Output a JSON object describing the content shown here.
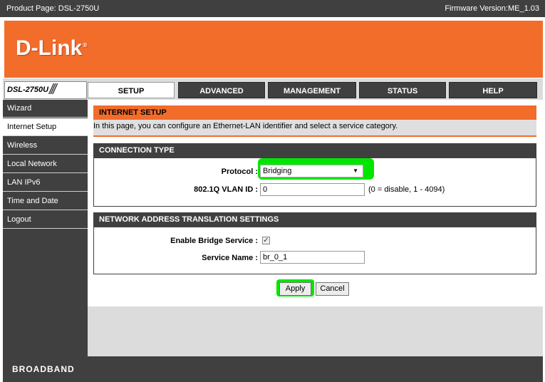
{
  "header": {
    "product_page": "Product Page: DSL-2750U",
    "firmware": "Firmware Version:ME_1.03",
    "logo": "D-Link",
    "model": "DSL-2750U"
  },
  "tabs": [
    {
      "label": "SETUP",
      "active": true
    },
    {
      "label": "ADVANCED"
    },
    {
      "label": "MANAGEMENT"
    },
    {
      "label": "STATUS"
    },
    {
      "label": "HELP"
    }
  ],
  "sidebar": {
    "items": [
      {
        "label": "Wizard"
      },
      {
        "label": "Internet Setup",
        "active": true
      },
      {
        "label": "Wireless"
      },
      {
        "label": "Local Network"
      },
      {
        "label": "LAN IPv6"
      },
      {
        "label": "Time and Date"
      },
      {
        "label": "Logout"
      }
    ]
  },
  "internet_setup": {
    "title": "INTERNET SETUP",
    "description": "In this page, you can configure an Ethernet-LAN identifier and select a service category."
  },
  "connection_type": {
    "title": "CONNECTION TYPE",
    "protocol_label": "Protocol :",
    "protocol_value": "Bridging",
    "vlan_label": "802.1Q VLAN ID :",
    "vlan_value": "0",
    "vlan_hint": "(0 = disable, 1 - 4094)"
  },
  "nat": {
    "title": "NETWORK ADDRESS TRANSLATION SETTINGS",
    "bridge_label": "Enable Bridge Service :",
    "bridge_checked": true,
    "service_label": "Service Name :",
    "service_value": "br_0_1"
  },
  "buttons": {
    "apply": "Apply",
    "cancel": "Cancel"
  },
  "footer": {
    "brand": "BROADBAND"
  },
  "colors": {
    "accent": "#f26c2a",
    "dark": "#404040",
    "highlight": "#00e600"
  }
}
